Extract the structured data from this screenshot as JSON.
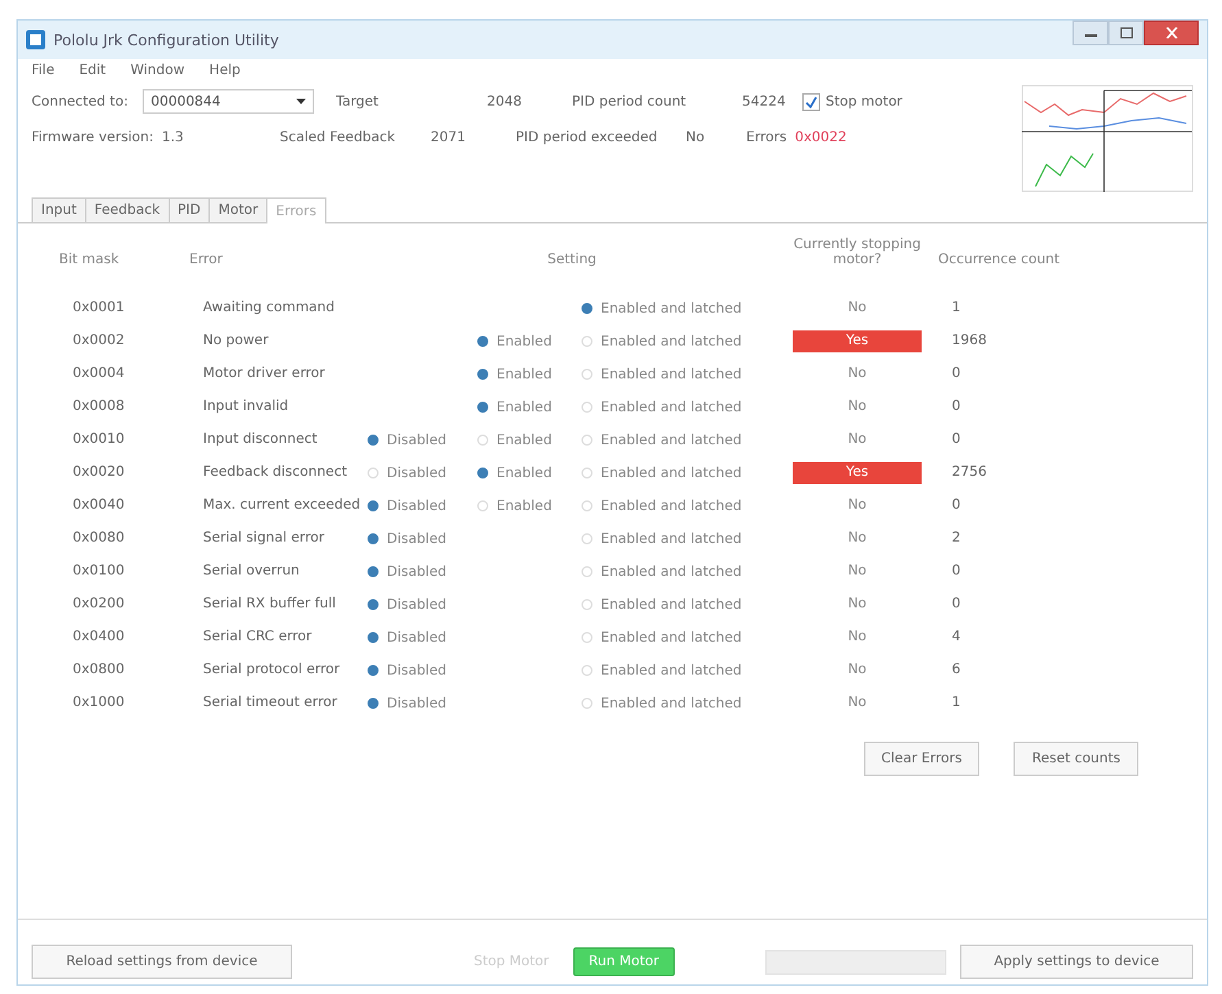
{
  "window": {
    "title": "Pololu Jrk Configuration Utility"
  },
  "menu": [
    "File",
    "Edit",
    "Window",
    "Help"
  ],
  "status": {
    "connected_label": "Connected to:",
    "device": "00000844",
    "firmware_label": "Firmware version:",
    "firmware": "1.3",
    "target_label": "Target",
    "target": "2048",
    "feedback_label": "Scaled Feedback",
    "feedback": "2071",
    "pid_count_label": "PID period count",
    "pid_count": "54224",
    "pid_exceeded_label": "PID period exceeded",
    "pid_exceeded": "No",
    "stop_label": "Stop motor",
    "stop_checked": true,
    "errors_label": "Errors",
    "errors": "0x0022"
  },
  "tabs": [
    {
      "label": "Input",
      "selected": false
    },
    {
      "label": "Feedback",
      "selected": false
    },
    {
      "label": "PID",
      "selected": false
    },
    {
      "label": "Motor",
      "selected": false
    },
    {
      "label": "Errors",
      "selected": true
    }
  ],
  "table": {
    "columns": [
      "Bit mask",
      "Error",
      "Setting",
      "Currently stopping motor?",
      "Occurrence count"
    ],
    "rows": [
      {
        "mask": "0x0001",
        "error": "Awaiting command",
        "options": [
          {
            "kind": "latched",
            "label": "Enabled and latched",
            "selected": true
          }
        ],
        "stopping": false,
        "stop_text": "No",
        "count": "1"
      },
      {
        "mask": "0x0002",
        "error": "No power",
        "options": [
          {
            "kind": "enabled",
            "label": "Enabled",
            "selected": true
          },
          {
            "kind": "latched",
            "label": "Enabled and latched",
            "selected": false
          }
        ],
        "stopping": true,
        "stop_text": "Yes",
        "count": "1968"
      },
      {
        "mask": "0x0004",
        "error": "Motor driver error",
        "options": [
          {
            "kind": "enabled",
            "label": "Enabled",
            "selected": true
          },
          {
            "kind": "latched",
            "label": "Enabled and latched",
            "selected": false
          }
        ],
        "stopping": false,
        "stop_text": "No",
        "count": "0"
      },
      {
        "mask": "0x0008",
        "error": "Input invalid",
        "options": [
          {
            "kind": "enabled",
            "label": "Enabled",
            "selected": true
          },
          {
            "kind": "latched",
            "label": "Enabled and latched",
            "selected": false
          }
        ],
        "stopping": false,
        "stop_text": "No",
        "count": "0"
      },
      {
        "mask": "0x0010",
        "error": "Input disconnect",
        "options": [
          {
            "kind": "disabled",
            "label": "Disabled",
            "selected": true
          },
          {
            "kind": "enabled",
            "label": "Enabled",
            "selected": false
          },
          {
            "kind": "latched",
            "label": "Enabled and latched",
            "selected": false
          }
        ],
        "stopping": false,
        "stop_text": "No",
        "count": "0"
      },
      {
        "mask": "0x0020",
        "error": "Feedback disconnect",
        "options": [
          {
            "kind": "disabled",
            "label": "Disabled",
            "selected": false
          },
          {
            "kind": "enabled",
            "label": "Enabled",
            "selected": true
          },
          {
            "kind": "latched",
            "label": "Enabled and latched",
            "selected": false
          }
        ],
        "stopping": true,
        "stop_text": "Yes",
        "count": "2756"
      },
      {
        "mask": "0x0040",
        "error": "Max. current exceeded",
        "options": [
          {
            "kind": "disabled",
            "label": "Disabled",
            "selected": true
          },
          {
            "kind": "enabled",
            "label": "Enabled",
            "selected": false
          },
          {
            "kind": "latched",
            "label": "Enabled and latched",
            "selected": false
          }
        ],
        "stopping": false,
        "stop_text": "No",
        "count": "0"
      },
      {
        "mask": "0x0080",
        "error": "Serial signal error",
        "options": [
          {
            "kind": "disabled",
            "label": "Disabled",
            "selected": true
          },
          {
            "kind": "latched",
            "label": "Enabled and latched",
            "selected": false
          }
        ],
        "stopping": false,
        "stop_text": "No",
        "count": "2"
      },
      {
        "mask": "0x0100",
        "error": "Serial overrun",
        "options": [
          {
            "kind": "disabled",
            "label": "Disabled",
            "selected": true
          },
          {
            "kind": "latched",
            "label": "Enabled and latched",
            "selected": false
          }
        ],
        "stopping": false,
        "stop_text": "No",
        "count": "0"
      },
      {
        "mask": "0x0200",
        "error": "Serial RX buffer full",
        "options": [
          {
            "kind": "disabled",
            "label": "Disabled",
            "selected": true
          },
          {
            "kind": "latched",
            "label": "Enabled and latched",
            "selected": false
          }
        ],
        "stopping": false,
        "stop_text": "No",
        "count": "0"
      },
      {
        "mask": "0x0400",
        "error": "Serial CRC error",
        "options": [
          {
            "kind": "disabled",
            "label": "Disabled",
            "selected": true
          },
          {
            "kind": "latched",
            "label": "Enabled and latched",
            "selected": false
          }
        ],
        "stopping": false,
        "stop_text": "No",
        "count": "4"
      },
      {
        "mask": "0x0800",
        "error": "Serial protocol error",
        "options": [
          {
            "kind": "disabled",
            "label": "Disabled",
            "selected": true
          },
          {
            "kind": "latched",
            "label": "Enabled and latched",
            "selected": false
          }
        ],
        "stopping": false,
        "stop_text": "No",
        "count": "6"
      },
      {
        "mask": "0x1000",
        "error": "Serial timeout error",
        "options": [
          {
            "kind": "disabled",
            "label": "Disabled",
            "selected": true
          },
          {
            "kind": "latched",
            "label": "Enabled and latched",
            "selected": false
          }
        ],
        "stopping": false,
        "stop_text": "No",
        "count": "1"
      }
    ]
  },
  "table_buttons": [
    "Clear Errors",
    "Reset counts"
  ],
  "footer": {
    "reload": "Reload settings from device",
    "stop_motor": {
      "label": "Stop Motor",
      "disabled": true
    },
    "run_motor": "Run Motor",
    "progress": {
      "level": 0
    },
    "apply": "Apply settings to device"
  }
}
